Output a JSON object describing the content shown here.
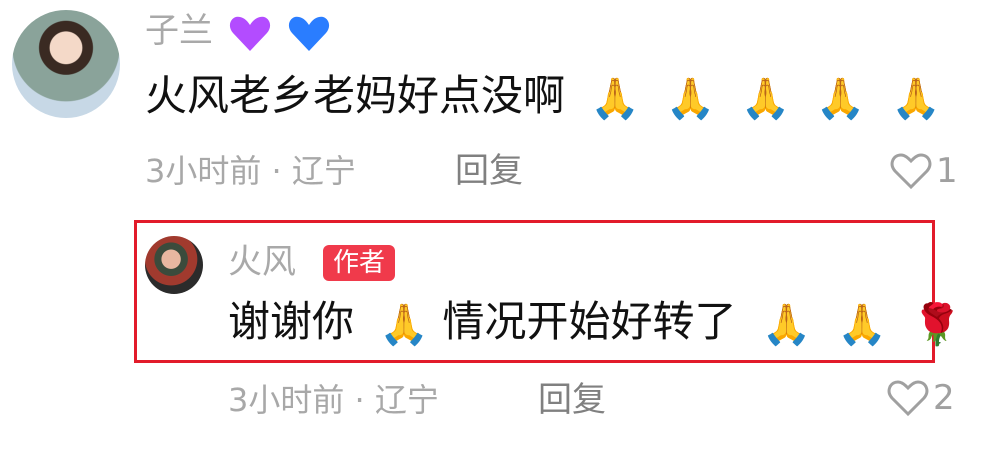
{
  "comments": {
    "main": {
      "username": "子兰",
      "heart_1_icon": "purple-heart-icon",
      "heart_2_icon": "blue-heart-icon",
      "text": "火风老乡老妈好点没啊",
      "prayer_emojis": [
        "🙏",
        "🙏",
        "🙏",
        "🙏",
        "🙏"
      ],
      "time": "3小时前",
      "location": "辽宁",
      "meta": "3小时前 · 辽宁",
      "reply_label": "回复",
      "likes": "1",
      "colors": {
        "username": "#a9a9a9",
        "text": "#111111",
        "meta": "#a8a8a8"
      }
    },
    "reply": {
      "username": "火风",
      "badge": "作者",
      "text_part_1": "谢谢你",
      "emoji_1": "🙏",
      "text_part_2": "情况开始好转了",
      "emoji_2": "🙏",
      "emoji_3": "🙏",
      "emoji_4": "🌹",
      "meta": "3小时前 · 辽宁",
      "reply_label": "回复",
      "likes": "2",
      "colors": {
        "badge_bg": "#f03a4b",
        "highlight_border": "#e21b2a"
      }
    }
  }
}
